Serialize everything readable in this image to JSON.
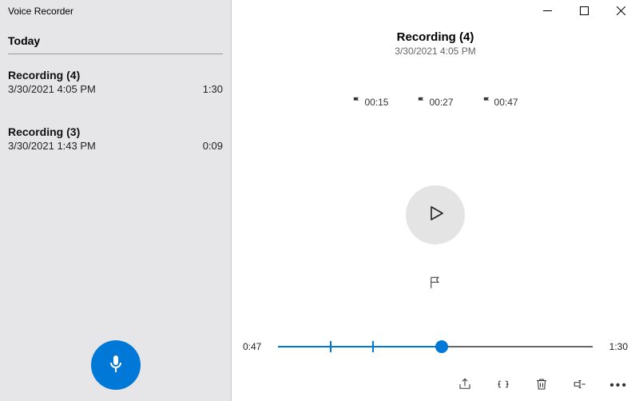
{
  "app_title": "Voice Recorder",
  "section_header": "Today",
  "recordings": [
    {
      "title": "Recording (4)",
      "date": "3/30/2021 4:05 PM",
      "duration": "1:30"
    },
    {
      "title": "Recording (3)",
      "date": "3/30/2021 1:43 PM",
      "duration": "0:09"
    }
  ],
  "detail": {
    "title": "Recording (4)",
    "date": "3/30/2021 4:05 PM",
    "markers": [
      "00:15",
      "00:27",
      "00:47"
    ],
    "elapsed": "0:47",
    "total": "1:30"
  },
  "icons": {
    "minimize": "minimize",
    "maximize": "maximize",
    "close": "close",
    "mic": "microphone",
    "play": "play",
    "flag": "flag",
    "share": "share",
    "trim": "trim",
    "delete": "delete",
    "rename": "rename",
    "more": "more"
  }
}
